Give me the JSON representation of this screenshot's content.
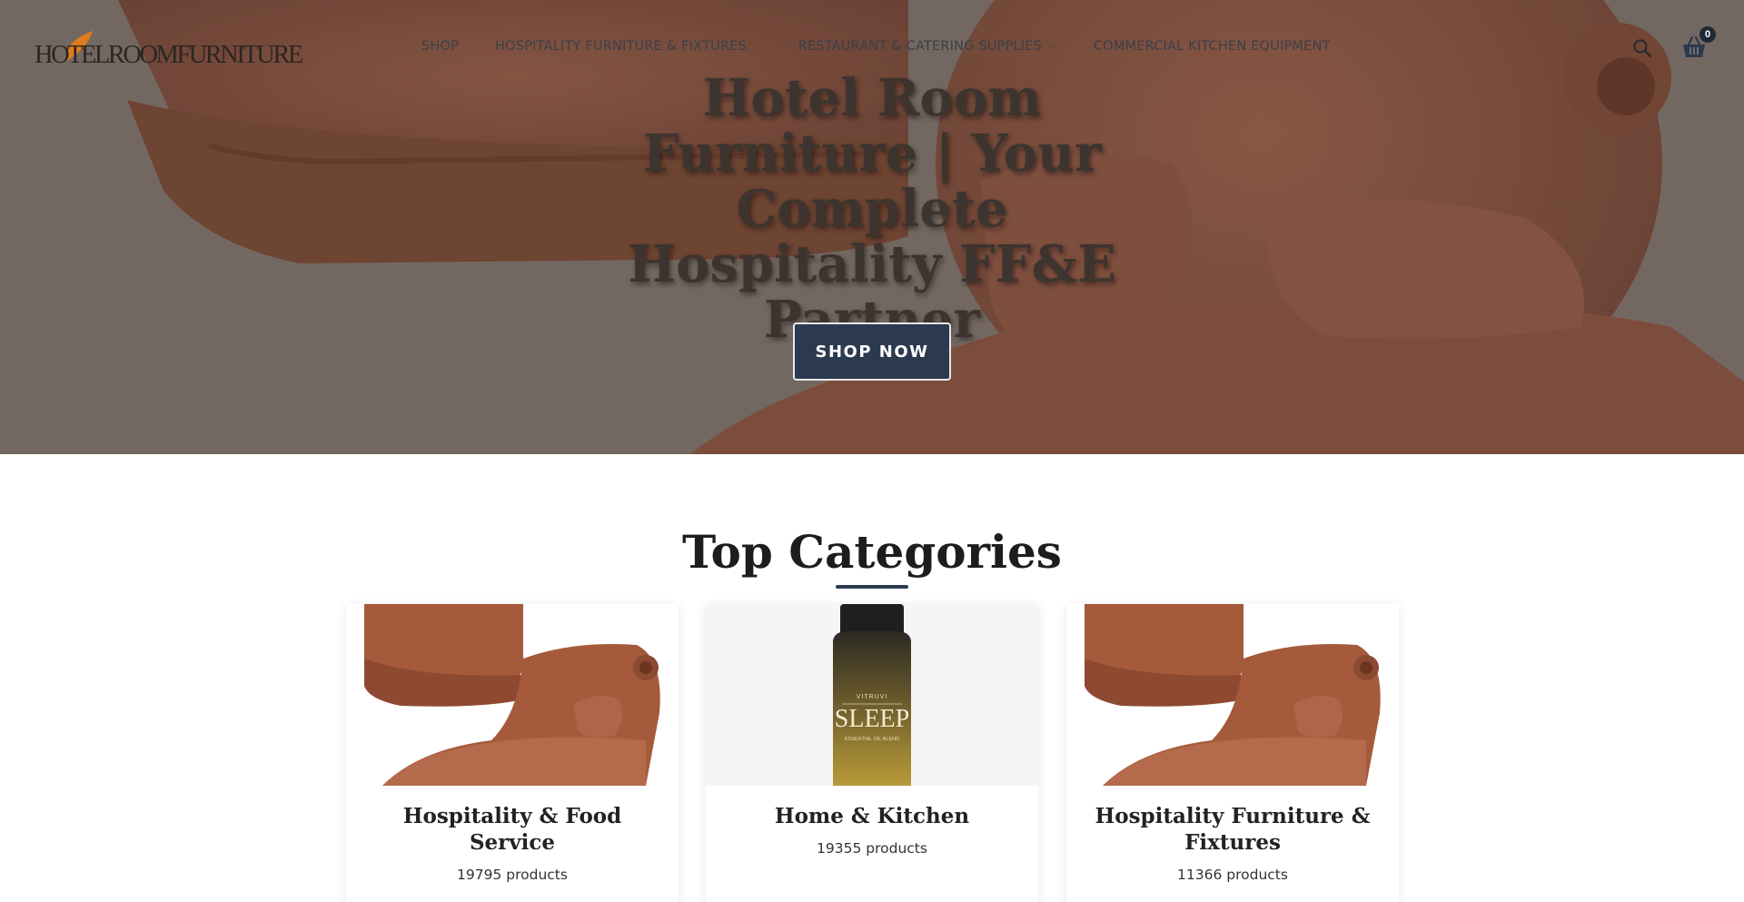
{
  "header": {
    "logo_text": "HOTELROOMFURNITURE",
    "nav": [
      {
        "label": "SHOP",
        "has_dropdown": false
      },
      {
        "label": "HOSPITALITY FURNITURE & FIXTURES",
        "has_dropdown": true
      },
      {
        "label": "RESTAURANT & CATERING SUPPLIES",
        "has_dropdown": true
      },
      {
        "label": "COMMERCIAL KITCHEN EQUIPMENT",
        "has_dropdown": false
      }
    ],
    "search_icon": "search-icon",
    "cart_icon": "basket-icon",
    "cart_count": "0"
  },
  "hero": {
    "title": "Hotel Room Furniture | Your Complete Hospitality FF&E Partner",
    "cta_label": "SHOP NOW"
  },
  "categories": {
    "title": "Top Categories",
    "items": [
      {
        "name": "Hospitality & Food Service",
        "count": "19795 products"
      },
      {
        "name": "Home & Kitchen",
        "count": "19355 products"
      },
      {
        "name": "Hospitality Furniture & Fixtures",
        "count": "11366 products"
      }
    ]
  },
  "product_label": {
    "brand": "VITRUVI",
    "name": "SLEEP",
    "sub": "ESSENTIAL OIL BLEND"
  },
  "colors": {
    "accent": "#2b3a4e",
    "logo_orange": "#e07a1f",
    "plush": "#a55a3c"
  }
}
